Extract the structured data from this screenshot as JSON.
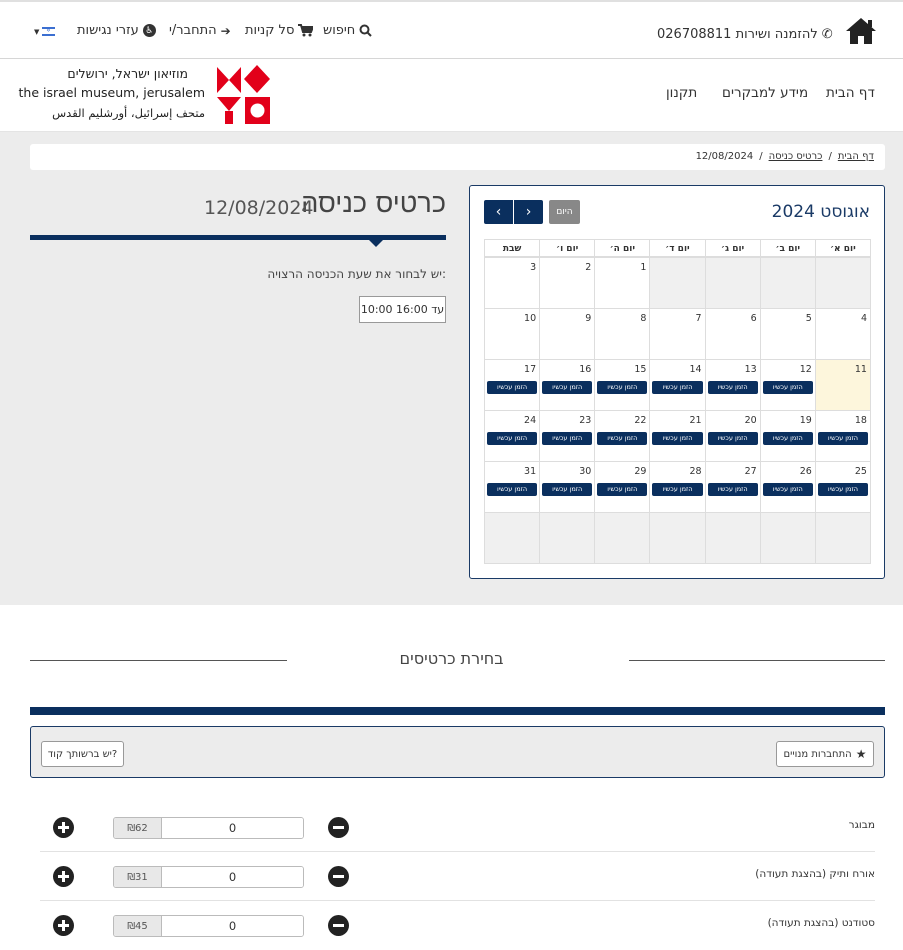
{
  "topbar": {
    "phone_label": "להזמנה ושירות 026708811",
    "search_label": "חיפוש",
    "cart_label": "סל קניות",
    "login_label": "התחבר/י",
    "accessibility_label": "עזרי נגישות"
  },
  "nav": {
    "home": "דף הבית",
    "visitor_info": "מידע למבקרים",
    "regulations": "תקנון"
  },
  "logo": {
    "line_he": "מוזיאון ישראל, ירושלים",
    "line_en": "the israel museum, jerusalem",
    "line_ar": "متحف إسرائيل، أورشليم القدس"
  },
  "breadcrumb": {
    "home": "דף הבית",
    "sep": "/",
    "tickets": "כרטיס כניסה",
    "date": "12/08/2024"
  },
  "calendar": {
    "title": "אוגוסט 2024",
    "today_label": "היום",
    "prev_label": "‹",
    "next_label": "›",
    "book_label": "הזמן עכשיו",
    "weekdays": [
      "יום א׳",
      "יום ב׳",
      "יום ג׳",
      "יום ד׳",
      "יום ה׳",
      "יום ו׳",
      "שבת"
    ],
    "weeks": [
      [
        "",
        "",
        "",
        "",
        "1",
        "2",
        "3"
      ],
      [
        "4",
        "5",
        "6",
        "7",
        "8",
        "9",
        "10"
      ],
      [
        "11",
        "12",
        "13",
        "14",
        "15",
        "16",
        "17"
      ],
      [
        "18",
        "19",
        "20",
        "21",
        "22",
        "23",
        "24"
      ],
      [
        "25",
        "26",
        "27",
        "28",
        "29",
        "30",
        "31"
      ],
      [
        "",
        "",
        "",
        "",
        "",
        "",
        ""
      ]
    ],
    "bookable_from": 12,
    "today": 11
  },
  "ticket": {
    "title": "כרטיס כניסה",
    "date": "12/08/2024",
    "choose_time": "יש לבחור את שעת הכניסה הרצויה:",
    "time_slot": "10:00 עד 16:00"
  },
  "tickets_section": {
    "title": "בחירת כרטיסים",
    "member_login": "התחברות מנויים",
    "promo_code": "יש ברשותך קוד?",
    "rows": [
      {
        "label": "מבוגר",
        "price": "₪62",
        "qty": "0"
      },
      {
        "label": "אורח ותיק (בהצגת תעודה)",
        "price": "₪31",
        "qty": "0"
      },
      {
        "label": "סטודנט (בהצגת תעודה)",
        "price": "₪45",
        "qty": "0"
      }
    ]
  },
  "colors": {
    "primary": "#0a2f5e",
    "logo_red": "#e2001a",
    "today_bg": "#fdf6dc"
  }
}
